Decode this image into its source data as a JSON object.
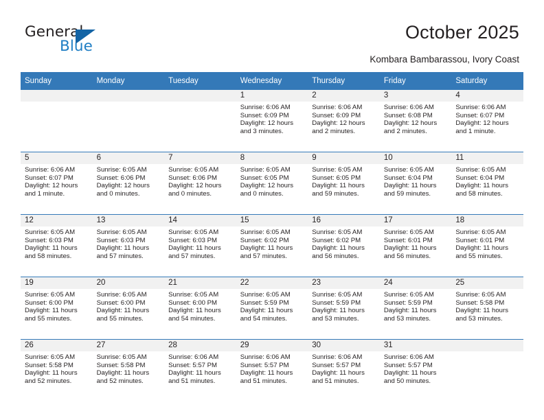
{
  "brand": {
    "name_part1": "General",
    "name_part2": "Blue",
    "accent_color": "#1f7ec4",
    "triangle_color": "#1464a5"
  },
  "header": {
    "title": "October 2025",
    "subtitle": "Kombara Bambarassou, Ivory Coast",
    "header_bg": "#3479b8",
    "daynum_bg": "#f1f1f1"
  },
  "weekday_headers": [
    "Sunday",
    "Monday",
    "Tuesday",
    "Wednesday",
    "Thursday",
    "Friday",
    "Saturday"
  ],
  "labels": {
    "sunrise_prefix": "Sunrise:",
    "sunset_prefix": "Sunset:",
    "daylight_prefix": "Daylight:"
  },
  "weeks": [
    [
      {
        "day": "",
        "empty": true
      },
      {
        "day": "",
        "empty": true
      },
      {
        "day": "",
        "empty": true
      },
      {
        "day": "1",
        "sunrise": "Sunrise: 6:06 AM",
        "sunset": "Sunset: 6:09 PM",
        "daylight_line1": "Daylight: 12 hours",
        "daylight_line2": "and 3 minutes."
      },
      {
        "day": "2",
        "sunrise": "Sunrise: 6:06 AM",
        "sunset": "Sunset: 6:09 PM",
        "daylight_line1": "Daylight: 12 hours",
        "daylight_line2": "and 2 minutes."
      },
      {
        "day": "3",
        "sunrise": "Sunrise: 6:06 AM",
        "sunset": "Sunset: 6:08 PM",
        "daylight_line1": "Daylight: 12 hours",
        "daylight_line2": "and 2 minutes."
      },
      {
        "day": "4",
        "sunrise": "Sunrise: 6:06 AM",
        "sunset": "Sunset: 6:07 PM",
        "daylight_line1": "Daylight: 12 hours",
        "daylight_line2": "and 1 minute."
      }
    ],
    [
      {
        "day": "5",
        "sunrise": "Sunrise: 6:06 AM",
        "sunset": "Sunset: 6:07 PM",
        "daylight_line1": "Daylight: 12 hours",
        "daylight_line2": "and 1 minute."
      },
      {
        "day": "6",
        "sunrise": "Sunrise: 6:05 AM",
        "sunset": "Sunset: 6:06 PM",
        "daylight_line1": "Daylight: 12 hours",
        "daylight_line2": "and 0 minutes."
      },
      {
        "day": "7",
        "sunrise": "Sunrise: 6:05 AM",
        "sunset": "Sunset: 6:06 PM",
        "daylight_line1": "Daylight: 12 hours",
        "daylight_line2": "and 0 minutes."
      },
      {
        "day": "8",
        "sunrise": "Sunrise: 6:05 AM",
        "sunset": "Sunset: 6:05 PM",
        "daylight_line1": "Daylight: 12 hours",
        "daylight_line2": "and 0 minutes."
      },
      {
        "day": "9",
        "sunrise": "Sunrise: 6:05 AM",
        "sunset": "Sunset: 6:05 PM",
        "daylight_line1": "Daylight: 11 hours",
        "daylight_line2": "and 59 minutes."
      },
      {
        "day": "10",
        "sunrise": "Sunrise: 6:05 AM",
        "sunset": "Sunset: 6:04 PM",
        "daylight_line1": "Daylight: 11 hours",
        "daylight_line2": "and 59 minutes."
      },
      {
        "day": "11",
        "sunrise": "Sunrise: 6:05 AM",
        "sunset": "Sunset: 6:04 PM",
        "daylight_line1": "Daylight: 11 hours",
        "daylight_line2": "and 58 minutes."
      }
    ],
    [
      {
        "day": "12",
        "sunrise": "Sunrise: 6:05 AM",
        "sunset": "Sunset: 6:03 PM",
        "daylight_line1": "Daylight: 11 hours",
        "daylight_line2": "and 58 minutes."
      },
      {
        "day": "13",
        "sunrise": "Sunrise: 6:05 AM",
        "sunset": "Sunset: 6:03 PM",
        "daylight_line1": "Daylight: 11 hours",
        "daylight_line2": "and 57 minutes."
      },
      {
        "day": "14",
        "sunrise": "Sunrise: 6:05 AM",
        "sunset": "Sunset: 6:03 PM",
        "daylight_line1": "Daylight: 11 hours",
        "daylight_line2": "and 57 minutes."
      },
      {
        "day": "15",
        "sunrise": "Sunrise: 6:05 AM",
        "sunset": "Sunset: 6:02 PM",
        "daylight_line1": "Daylight: 11 hours",
        "daylight_line2": "and 57 minutes."
      },
      {
        "day": "16",
        "sunrise": "Sunrise: 6:05 AM",
        "sunset": "Sunset: 6:02 PM",
        "daylight_line1": "Daylight: 11 hours",
        "daylight_line2": "and 56 minutes."
      },
      {
        "day": "17",
        "sunrise": "Sunrise: 6:05 AM",
        "sunset": "Sunset: 6:01 PM",
        "daylight_line1": "Daylight: 11 hours",
        "daylight_line2": "and 56 minutes."
      },
      {
        "day": "18",
        "sunrise": "Sunrise: 6:05 AM",
        "sunset": "Sunset: 6:01 PM",
        "daylight_line1": "Daylight: 11 hours",
        "daylight_line2": "and 55 minutes."
      }
    ],
    [
      {
        "day": "19",
        "sunrise": "Sunrise: 6:05 AM",
        "sunset": "Sunset: 6:00 PM",
        "daylight_line1": "Daylight: 11 hours",
        "daylight_line2": "and 55 minutes."
      },
      {
        "day": "20",
        "sunrise": "Sunrise: 6:05 AM",
        "sunset": "Sunset: 6:00 PM",
        "daylight_line1": "Daylight: 11 hours",
        "daylight_line2": "and 55 minutes."
      },
      {
        "day": "21",
        "sunrise": "Sunrise: 6:05 AM",
        "sunset": "Sunset: 6:00 PM",
        "daylight_line1": "Daylight: 11 hours",
        "daylight_line2": "and 54 minutes."
      },
      {
        "day": "22",
        "sunrise": "Sunrise: 6:05 AM",
        "sunset": "Sunset: 5:59 PM",
        "daylight_line1": "Daylight: 11 hours",
        "daylight_line2": "and 54 minutes."
      },
      {
        "day": "23",
        "sunrise": "Sunrise: 6:05 AM",
        "sunset": "Sunset: 5:59 PM",
        "daylight_line1": "Daylight: 11 hours",
        "daylight_line2": "and 53 minutes."
      },
      {
        "day": "24",
        "sunrise": "Sunrise: 6:05 AM",
        "sunset": "Sunset: 5:59 PM",
        "daylight_line1": "Daylight: 11 hours",
        "daylight_line2": "and 53 minutes."
      },
      {
        "day": "25",
        "sunrise": "Sunrise: 6:05 AM",
        "sunset": "Sunset: 5:58 PM",
        "daylight_line1": "Daylight: 11 hours",
        "daylight_line2": "and 53 minutes."
      }
    ],
    [
      {
        "day": "26",
        "sunrise": "Sunrise: 6:05 AM",
        "sunset": "Sunset: 5:58 PM",
        "daylight_line1": "Daylight: 11 hours",
        "daylight_line2": "and 52 minutes."
      },
      {
        "day": "27",
        "sunrise": "Sunrise: 6:05 AM",
        "sunset": "Sunset: 5:58 PM",
        "daylight_line1": "Daylight: 11 hours",
        "daylight_line2": "and 52 minutes."
      },
      {
        "day": "28",
        "sunrise": "Sunrise: 6:06 AM",
        "sunset": "Sunset: 5:57 PM",
        "daylight_line1": "Daylight: 11 hours",
        "daylight_line2": "and 51 minutes."
      },
      {
        "day": "29",
        "sunrise": "Sunrise: 6:06 AM",
        "sunset": "Sunset: 5:57 PM",
        "daylight_line1": "Daylight: 11 hours",
        "daylight_line2": "and 51 minutes."
      },
      {
        "day": "30",
        "sunrise": "Sunrise: 6:06 AM",
        "sunset": "Sunset: 5:57 PM",
        "daylight_line1": "Daylight: 11 hours",
        "daylight_line2": "and 51 minutes."
      },
      {
        "day": "31",
        "sunrise": "Sunrise: 6:06 AM",
        "sunset": "Sunset: 5:57 PM",
        "daylight_line1": "Daylight: 11 hours",
        "daylight_line2": "and 50 minutes."
      },
      {
        "day": "",
        "empty": true
      }
    ]
  ]
}
